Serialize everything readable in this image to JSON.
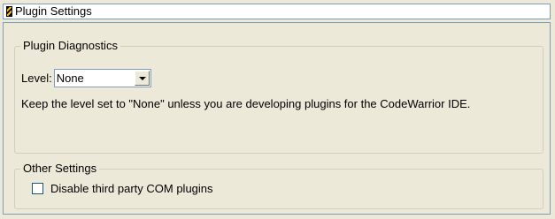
{
  "title": "Plugin Settings",
  "diagnostics": {
    "group_label": "Plugin Diagnostics",
    "level_label": "Level:",
    "level_value": "None",
    "help_text": "Keep the level set to \"None\" unless you are developing plugins for the CodeWarrior IDE."
  },
  "other": {
    "group_label": "Other Settings",
    "checkbox_label": "Disable third party COM plugins",
    "checkbox_checked": false
  },
  "icons": {
    "title_icon": "settings-panel-icon",
    "dropdown_icon": "chevron-down-icon"
  }
}
